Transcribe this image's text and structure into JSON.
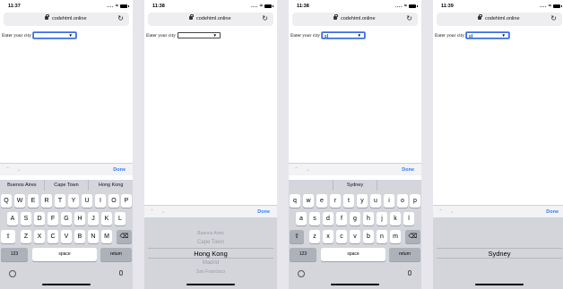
{
  "shared": {
    "url": "codehtml.online",
    "form_label": "Enter your city",
    "select_arrow": "▼",
    "done_label": "Done",
    "nav_arrows": "⌃ ⌄",
    "reload_glyph": "↻",
    "wifi_glyph": "≈",
    "dots": "....",
    "key_shift": "⇧",
    "key_backspace": "⌫",
    "key_numbers": "123",
    "key_space": "space",
    "key_return": "return",
    "colors": {
      "accent": "#2f7cf6",
      "keyboard_bg": "#d4d6dc",
      "key": "#ffffff",
      "dark_key": "#adb1b9"
    }
  },
  "screens": [
    {
      "time": "11:37",
      "select_value": "",
      "suggestions": [
        "Buenos Aires",
        "Cape Town",
        "Hong Kong"
      ],
      "keys_row1": [
        "Q",
        "W",
        "E",
        "R",
        "T",
        "Y",
        "U",
        "I",
        "O",
        "P"
      ],
      "keys_row2": [
        "A",
        "S",
        "D",
        "F",
        "G",
        "H",
        "J",
        "K",
        "L"
      ],
      "keys_row3": [
        "Z",
        "X",
        "C",
        "V",
        "B",
        "N",
        "M"
      ]
    },
    {
      "time": "11:38",
      "select_value": "",
      "picker_options": [
        "Buenos Aires",
        "Cape Town",
        "Hong Kong",
        "Madrid",
        "San Francisco"
      ],
      "picker_selected_index": 2
    },
    {
      "time": "11:38",
      "select_value": "s",
      "suggestions": [
        "",
        "Sydney",
        ""
      ],
      "keys_row1": [
        "q",
        "w",
        "e",
        "r",
        "t",
        "y",
        "u",
        "i",
        "o",
        "p"
      ],
      "keys_row2": [
        "a",
        "s",
        "d",
        "f",
        "g",
        "h",
        "j",
        "k",
        "l"
      ],
      "keys_row3": [
        "z",
        "x",
        "c",
        "v",
        "b",
        "n",
        "m"
      ]
    },
    {
      "time": "11:39",
      "select_value": "s",
      "picker_options": [
        "Sydney"
      ],
      "picker_selected_index": 0
    }
  ]
}
